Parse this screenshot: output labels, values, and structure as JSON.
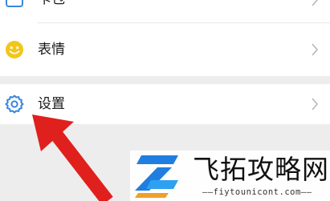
{
  "list": {
    "items": [
      {
        "id": "kabao",
        "label": "卡包",
        "icon": "card-wallet-icon"
      },
      {
        "id": "biaoqing",
        "label": "表情",
        "icon": "smiley-icon"
      },
      {
        "id": "settings",
        "label": "设置",
        "icon": "gear-icon"
      }
    ]
  },
  "colors": {
    "background": "#ededed",
    "row": "#ffffff",
    "smiley": "#f5c518",
    "gear": "#3b86d9",
    "arrow": "#e0201c",
    "chevron": "#b8b8b8"
  },
  "watermark": {
    "title": "飞拓攻略网",
    "url": "——fiytounicont.com——"
  }
}
